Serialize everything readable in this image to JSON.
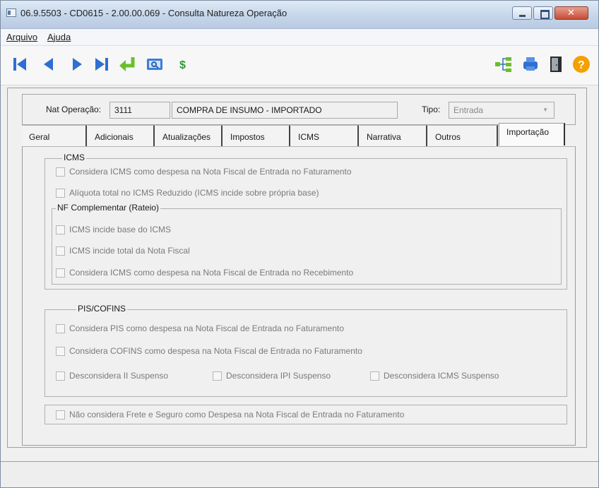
{
  "window": {
    "title": "06.9.5503 - CD0615 - 2.00.00.069 - Consulta Natureza Operação"
  },
  "menu": {
    "items": [
      "Arquivo",
      "Ajuda"
    ]
  },
  "toolbar": {
    "icons": [
      "first-record-icon",
      "previous-record-icon",
      "next-record-icon",
      "last-record-icon",
      "goto-record-icon",
      "search-icon",
      "dollar-icon",
      "tree-icon",
      "print-icon",
      "exit-door-icon",
      "help-icon"
    ]
  },
  "header": {
    "nat_label": "Nat Operação:",
    "nat_code": "3111",
    "nat_desc": "COMPRA DE INSUMO - IMPORTADO",
    "tipo_label": "Tipo:",
    "tipo_value": "Entrada"
  },
  "tabs": [
    "Geral",
    "Adicionais",
    "Atualizações",
    "Impostos",
    "ICMS",
    "Narrativa",
    "Outros",
    "Importação"
  ],
  "active_tab": "Importação",
  "icms_group": {
    "legend": "ICMS",
    "options": [
      "Considera ICMS como despesa na Nota Fiscal de Entrada no Faturamento",
      "Alíquota total no ICMS Reduzido (ICMS incide sobre própria base)"
    ],
    "nf_group": {
      "legend": "NF Complementar (Rateio)",
      "options": [
        "ICMS incide base do ICMS",
        "ICMS incide total da Nota Fiscal",
        "Considera ICMS como despesa na Nota Fiscal de Entrada no Recebimento"
      ]
    }
  },
  "pis_group": {
    "legend": "PIS/COFINS",
    "options": [
      "Considera PIS como despesa na Nota Fiscal de Entrada no Faturamento",
      "Considera COFINS como despesa na Nota Fiscal de Entrada no Faturamento"
    ],
    "inline_options": [
      "Desconsidera II Suspenso",
      "Desconsidera IPI Suspenso",
      "Desconsidera ICMS Suspenso"
    ]
  },
  "frete_option": "Não considera Frete e Seguro como Despesa na Nota Fiscal de Entrada no Faturamento",
  "colors": {
    "nav_blue": "#2f6fd1",
    "green_arrow": "#6bbf2a",
    "help_orange": "#f4a000"
  }
}
